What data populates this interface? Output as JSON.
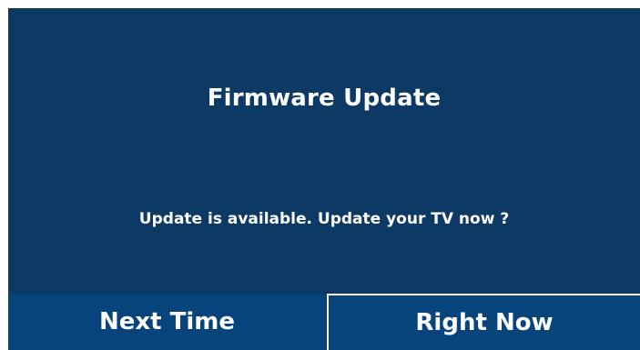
{
  "dialog": {
    "title": "Firmware Update",
    "message": "Update is available. Update your TV now ?",
    "buttons": {
      "next_time": "Next Time",
      "right_now": "Right Now"
    },
    "focused_button": "right_now"
  },
  "colors": {
    "background": "#0d3a64",
    "button_background": "#06447b",
    "focus_border": "#ffffff",
    "text": "#ffffff"
  }
}
